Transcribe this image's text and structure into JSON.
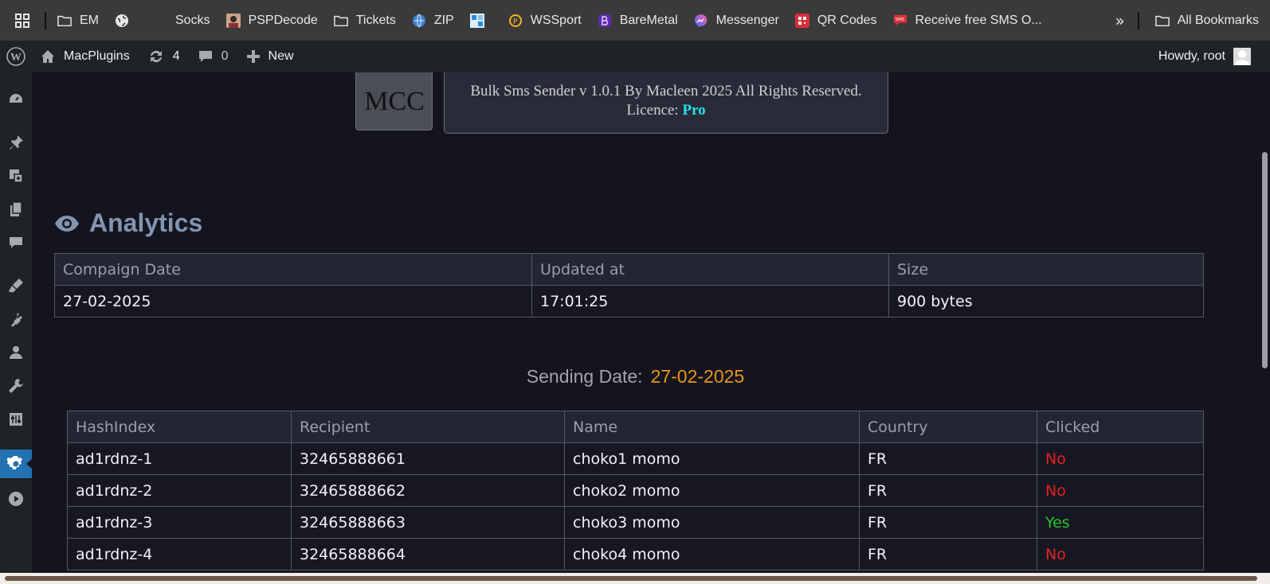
{
  "bookmarks": {
    "items": [
      {
        "label": "EM",
        "icon": "folder-icon"
      },
      {
        "label": "",
        "icon": "globe-icon"
      },
      {
        "label": "Socks",
        "icon": "blank-icon"
      },
      {
        "label": "PSPDecode",
        "icon": "avatar-icon"
      },
      {
        "label": "Tickets",
        "icon": "folder-icon"
      },
      {
        "label": "ZIP",
        "icon": "globe-blue-icon"
      },
      {
        "label": "",
        "icon": "puzzle-icon"
      },
      {
        "label": "WSSport",
        "icon": "coin-icon"
      },
      {
        "label": "BareMetal",
        "icon": "shield-icon"
      },
      {
        "label": "Messenger",
        "icon": "messenger-icon"
      },
      {
        "label": "QR Codes",
        "icon": "qr-icon"
      },
      {
        "label": "Receive free SMS O...",
        "icon": "sms-icon"
      }
    ],
    "more": "»",
    "all_bookmarks": "All Bookmarks"
  },
  "adminbar": {
    "site_name": "MacPlugins",
    "updates_count": "4",
    "comments_count": "0",
    "new_label": "New",
    "howdy": "Howdy, root"
  },
  "plugin": {
    "logo_text": "MCC",
    "credit_line": "Bulk Sms Sender v 1.0.1 By Macleen 2025 All Rights Reserved.",
    "licence_label": "Licence:",
    "licence_value": "Pro"
  },
  "analytics": {
    "title": "Analytics",
    "headers": [
      "Compaign Date",
      "Updated at",
      "Size"
    ],
    "row": [
      "27-02-2025",
      "17:01:25",
      "900 bytes"
    ]
  },
  "sending": {
    "label": "Sending Date:",
    "date": "27-02-2025"
  },
  "recipients": {
    "headers": [
      "HashIndex",
      "Recipient",
      "Name",
      "Country",
      "Clicked"
    ],
    "rows": [
      [
        "ad1rdnz-1",
        "32465888661",
        "choko1 momo",
        "FR",
        "No"
      ],
      [
        "ad1rdnz-2",
        "32465888662",
        "choko2 momo",
        "FR",
        "No"
      ],
      [
        "ad1rdnz-3",
        "32465888663",
        "choko3 momo",
        "FR",
        "Yes"
      ],
      [
        "ad1rdnz-4",
        "32465888664",
        "choko4 momo",
        "FR",
        "No"
      ]
    ]
  },
  "colors": {
    "accent_blue": "#2271b1",
    "pro": "#25e2ee",
    "date_orange": "#e8961c",
    "yes_green": "#29c52e",
    "no_red": "#e32222"
  }
}
